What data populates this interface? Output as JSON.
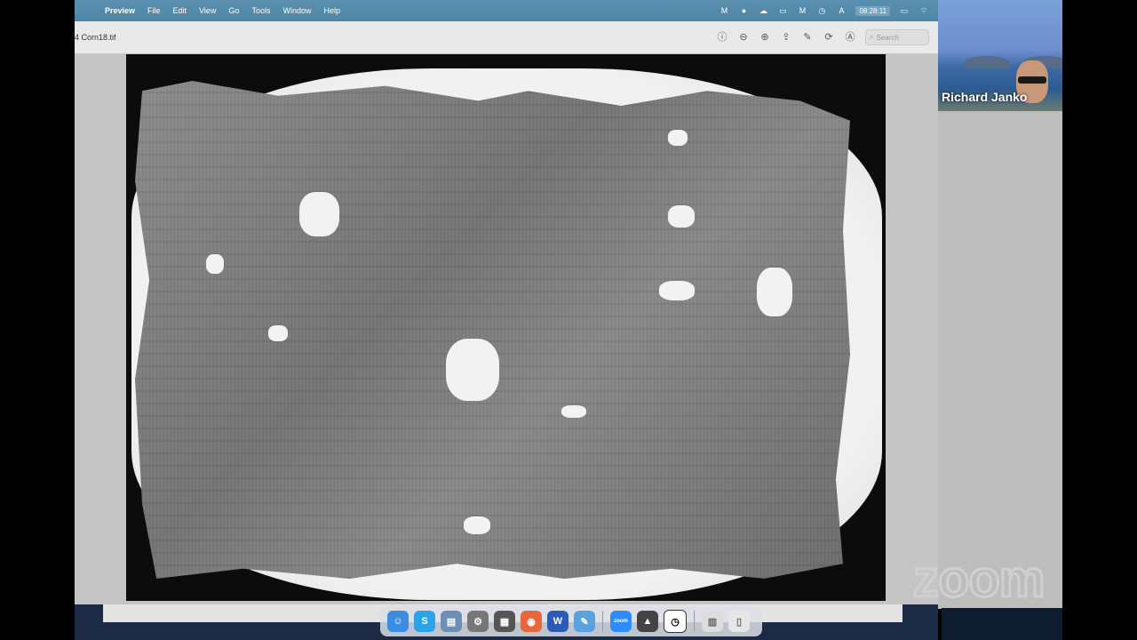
{
  "menubar": {
    "app_name": "Preview",
    "items": [
      "File",
      "Edit",
      "View",
      "Go",
      "Tools",
      "Window",
      "Help"
    ],
    "clock": "08:28:11"
  },
  "toolbar": {
    "doc_title": "4 Corn18.tif",
    "search_placeholder": "Search"
  },
  "video": {
    "participant_name": "Richard Janko"
  },
  "zoom_logo": "zoom",
  "dock": {
    "apps": [
      "finder",
      "skype",
      "preview",
      "settings",
      "calculator",
      "firefox",
      "word",
      "textedit",
      "zoom",
      "notes",
      "clock",
      "documents",
      "trash"
    ]
  }
}
